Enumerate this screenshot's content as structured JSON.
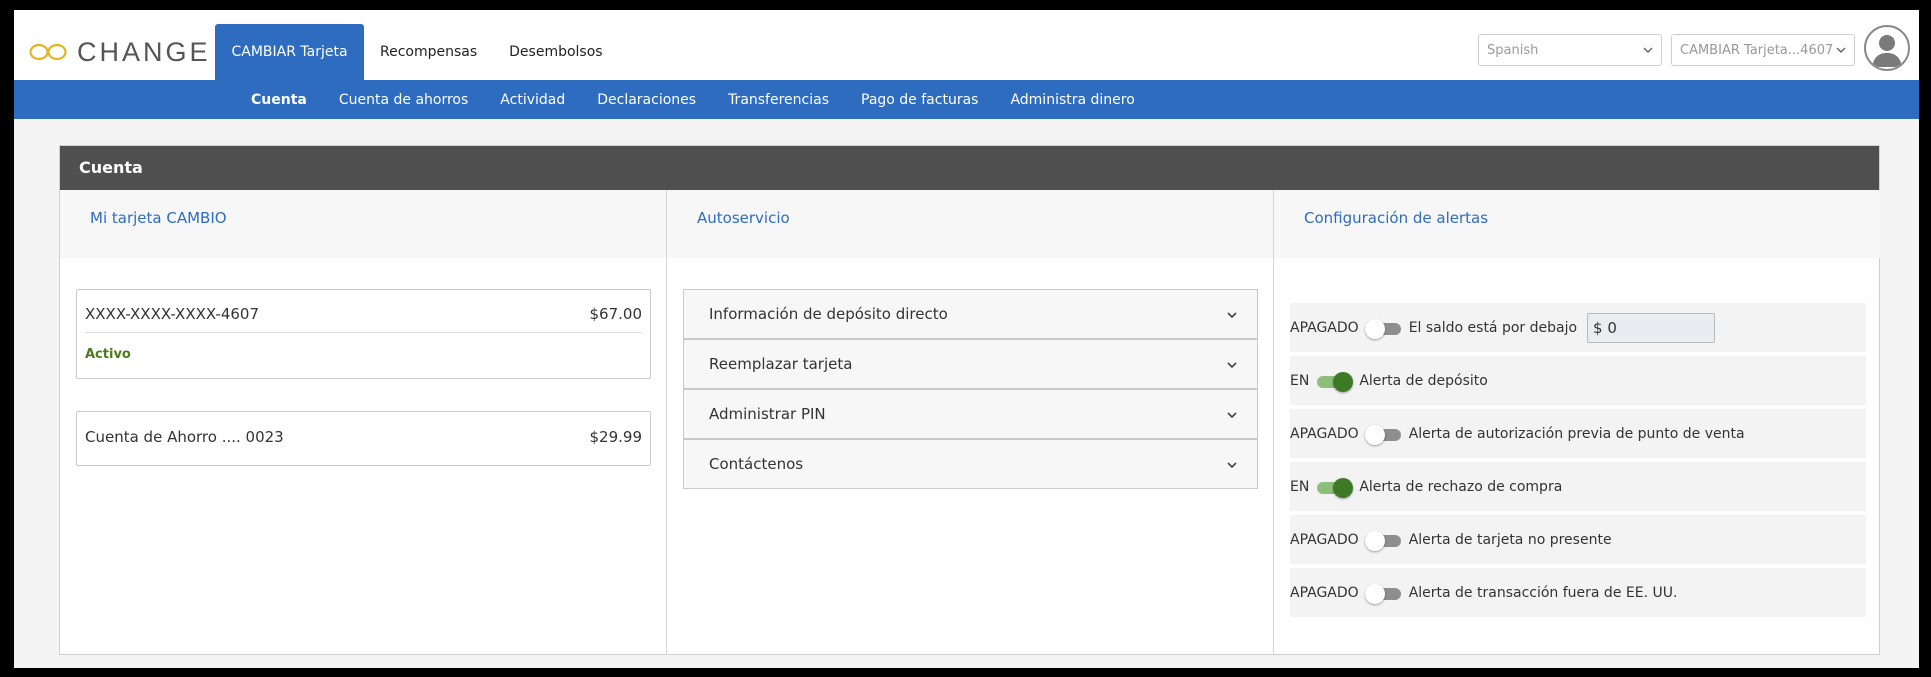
{
  "brand": {
    "name": "CHANGE"
  },
  "top_tabs": [
    {
      "label": "CAMBIAR Tarjeta",
      "active": true
    },
    {
      "label": "Recompensas",
      "active": false
    },
    {
      "label": "Desembolsos",
      "active": false
    }
  ],
  "language_select": {
    "value": "Spanish"
  },
  "account_select": {
    "value": "CAMBIAR Tarjeta...4607"
  },
  "subnav": [
    {
      "label": "Cuenta",
      "active": true
    },
    {
      "label": "Cuenta de ahorros"
    },
    {
      "label": "Actividad"
    },
    {
      "label": "Declaraciones"
    },
    {
      "label": "Transferencias"
    },
    {
      "label": "Pago de facturas"
    },
    {
      "label": "Administra dinero"
    }
  ],
  "panel": {
    "title": "Cuenta",
    "card_column": {
      "title": "Mi tarjeta CAMBIO",
      "card": {
        "number": "XXXX-XXXX-XXXX-4607",
        "balance": "$67.00",
        "status": "Activo"
      },
      "savings": {
        "name": "Cuenta de Ahorro .... 0023",
        "balance": "$29.99"
      }
    },
    "self_service": {
      "title": "Autoservicio",
      "items": [
        "Información de depósito directo",
        "Reemplazar tarjeta",
        "Administrar PIN",
        "Contáctenos"
      ]
    },
    "alerts": {
      "title": "Configuración de alertas",
      "items": [
        {
          "state": "APAGADO",
          "on": false,
          "label": "El saldo está por debajo",
          "amount": "$ 0"
        },
        {
          "state": "EN",
          "on": true,
          "label": "Alerta de depósito"
        },
        {
          "state": "APAGADO",
          "on": false,
          "label": "Alerta de autorización previa de punto de venta"
        },
        {
          "state": "EN",
          "on": true,
          "label": "Alerta de rechazo de compra"
        },
        {
          "state": "APAGADO",
          "on": false,
          "label": "Alerta de tarjeta no presente"
        },
        {
          "state": "APAGADO",
          "on": false,
          "label": "Alerta de transacción fuera de EE. UU."
        }
      ]
    }
  },
  "colors": {
    "primary_blue": "#2e6cc0",
    "header_dark": "#505050",
    "toggle_on": "#3e7a26",
    "status_green": "#4a7a1c",
    "logo_gold": "#e6b422"
  }
}
